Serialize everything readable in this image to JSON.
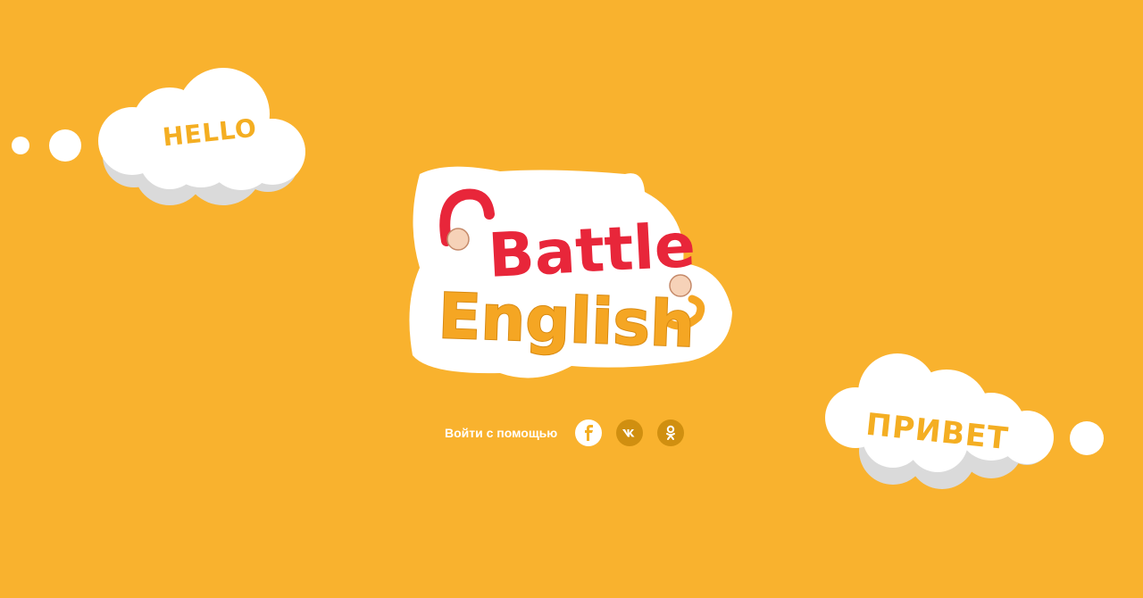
{
  "clouds": {
    "left_text": "HELLO",
    "right_text": "ПРИВЕТ"
  },
  "logo": {
    "line1": "Battle",
    "line2": "English"
  },
  "login": {
    "label": "Войти с помощью",
    "providers": [
      {
        "name": "facebook",
        "icon": "facebook-icon"
      },
      {
        "name": "vk",
        "icon": "vk-icon"
      },
      {
        "name": "odnoklassniki",
        "icon": "odnoklassniki-icon"
      }
    ]
  },
  "colors": {
    "background": "#F9B22E",
    "accent_red": "#E8263A",
    "cloud_white": "#FFFFFF",
    "social_dark": "#D08F10"
  }
}
